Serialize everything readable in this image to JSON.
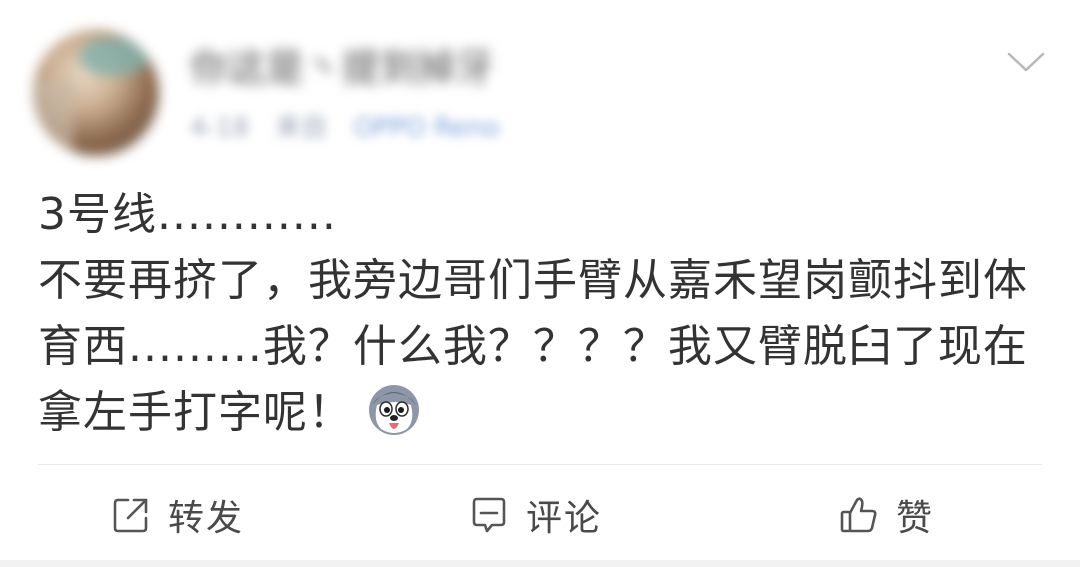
{
  "post": {
    "author": {
      "username": "你这是丶提到掉牙",
      "time": "4-18",
      "source_prefix": "来自",
      "source_device": "OPPO Reno"
    },
    "text": "3号线............\n不要再挤了，我旁边哥们手臂从嘉禾望岗颤抖到体育西.........我？什么我？？？？我又臂脱臼了现在拿左手打字呢！",
    "emoji": "husky-emoji"
  },
  "actions": {
    "repost_label": "转发",
    "comment_label": "评论",
    "like_label": "赞"
  },
  "colors": {
    "text": "#333333",
    "meta": "#9aa4b4",
    "divider": "#e9e9e9",
    "icon": "#555555"
  }
}
